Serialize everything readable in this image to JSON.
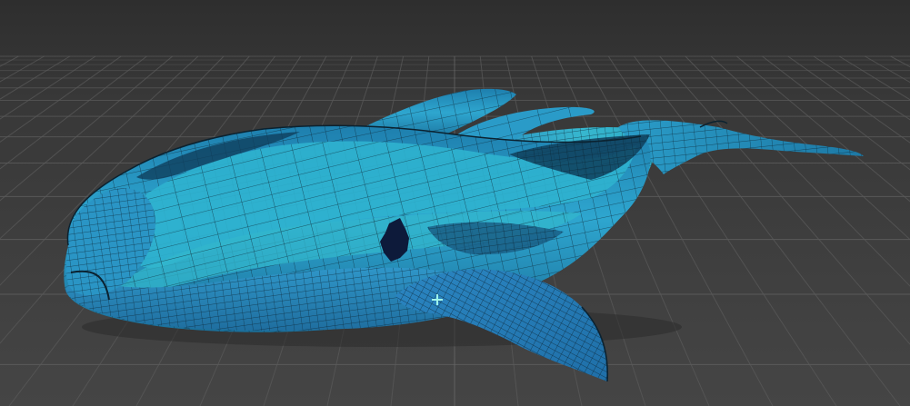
{
  "viewport": {
    "background_top": "#2f2f2f",
    "background_bottom": "#454545",
    "grid_color": "#5a5a5a",
    "grid_color_strong": "#6a6a6a"
  },
  "model": {
    "fill_primary": "#2a9bc4",
    "fill_light": "#3bbfd6",
    "fill_dark": "#1a6f96",
    "fill_shadow": "#0f3f5c",
    "wire_color": "#0b2230",
    "hole_color": "#0d1a3a"
  },
  "gizmo": {
    "icon": "pivot-cross-icon",
    "color": "#9ff4ea"
  }
}
